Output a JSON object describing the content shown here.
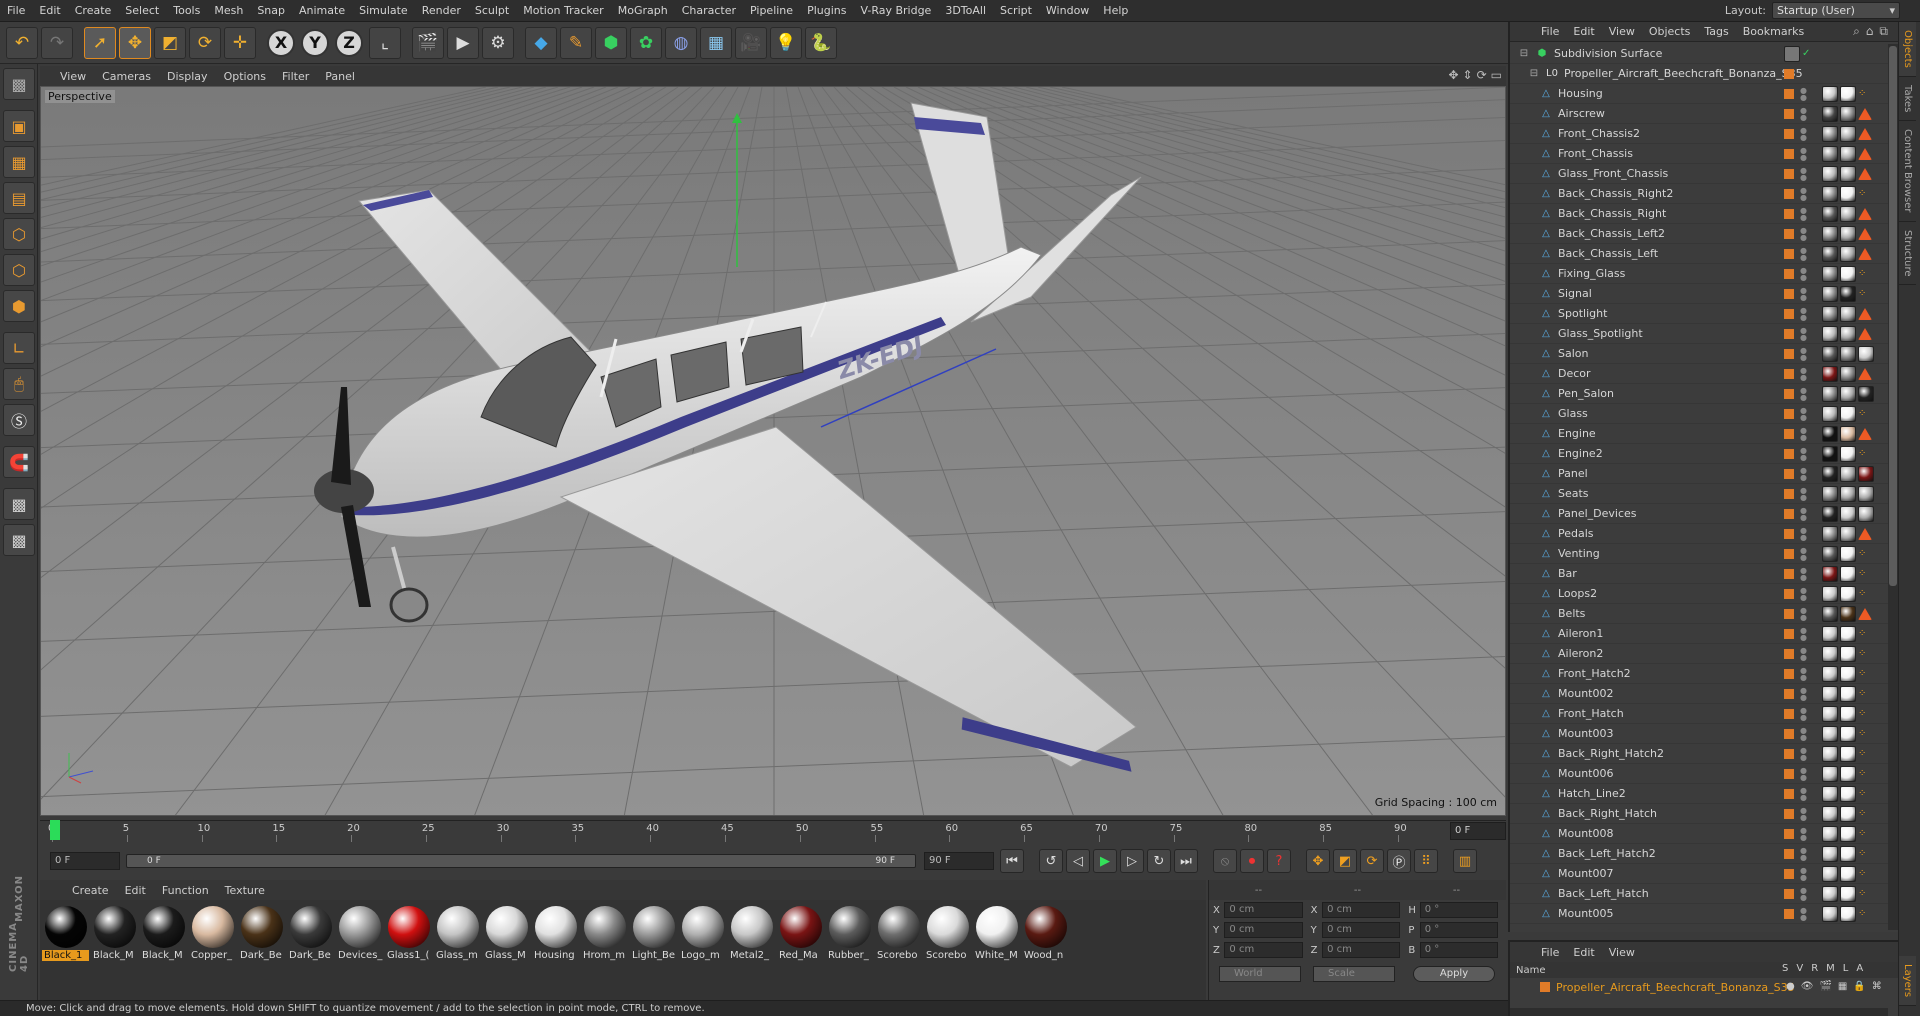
{
  "menubar": {
    "items": [
      "File",
      "Edit",
      "Create",
      "Select",
      "Tools",
      "Mesh",
      "Snap",
      "Animate",
      "Simulate",
      "Render",
      "Sculpt",
      "Motion Tracker",
      "MoGraph",
      "Character",
      "Pipeline",
      "Plugins",
      "V-Ray Bridge",
      "3DToAll",
      "Script",
      "Window",
      "Help"
    ],
    "layout_label": "Layout:",
    "layout_value": "Startup (User)"
  },
  "toolbar": {
    "axis_x": "X",
    "axis_y": "Y",
    "axis_z": "Z"
  },
  "viewport": {
    "menu": [
      "View",
      "Cameras",
      "Display",
      "Options",
      "Filter",
      "Panel"
    ],
    "label": "Perspective",
    "grid_spacing": "Grid Spacing : 100 cm",
    "tail_number": "ZK-EDJ"
  },
  "timeline": {
    "ticks": [
      "0",
      "5",
      "10",
      "15",
      "20",
      "25",
      "30",
      "35",
      "40",
      "45",
      "50",
      "55",
      "60",
      "65",
      "70",
      "75",
      "80",
      "85",
      "90"
    ],
    "end_frame": "0 F",
    "current_frame": "0 F",
    "range_start": "0 F",
    "range_end": "90 F",
    "max_frame": "90 F"
  },
  "materials": {
    "menu": [
      "Create",
      "Edit",
      "Function",
      "Texture"
    ],
    "items": [
      {
        "label": "Black_1",
        "color": "#050505",
        "selected": true
      },
      {
        "label": "Black_M",
        "color": "#222222"
      },
      {
        "label": "Black_M",
        "color": "#1b1b1b"
      },
      {
        "label": "Copper_",
        "color": "#d8b9a0"
      },
      {
        "label": "Dark_Be",
        "color": "#4a3218"
      },
      {
        "label": "Dark_Be",
        "color": "#3a3a3a"
      },
      {
        "label": "Devices_",
        "color": "#9a9a9a"
      },
      {
        "label": "Glass1_(",
        "color": "#d01010"
      },
      {
        "label": "Glass_m",
        "color": "#c4c4c4"
      },
      {
        "label": "Glass_M",
        "color": "#d8d8d8"
      },
      {
        "label": "Housing",
        "color": "#e0e0e0"
      },
      {
        "label": "Hrom_m",
        "color": "#888888"
      },
      {
        "label": "Light_Be",
        "color": "#9a9a9a"
      },
      {
        "label": "Logo_m",
        "color": "#b0b0b0"
      },
      {
        "label": "Metal2_",
        "color": "#c8c8c8"
      },
      {
        "label": "Red_Ma",
        "color": "#7a1414"
      },
      {
        "label": "Rubber_",
        "color": "#5c5c5c"
      },
      {
        "label": "Scorebo",
        "color": "#6e6e6e"
      },
      {
        "label": "Scorebo",
        "color": "#dadada"
      },
      {
        "label": "White_M",
        "color": "#f0f0f0"
      },
      {
        "label": "Wood_n",
        "color": "#5a1a12"
      }
    ]
  },
  "coords": {
    "head": [
      "--",
      "--",
      "--"
    ],
    "rows": [
      {
        "a": "X",
        "av": "0 cm",
        "b": "X",
        "bv": "0 cm",
        "c": "H",
        "cv": "0 °"
      },
      {
        "a": "Y",
        "av": "0 cm",
        "b": "Y",
        "bv": "0 cm",
        "c": "P",
        "cv": "0 °"
      },
      {
        "a": "Z",
        "av": "0 cm",
        "b": "Z",
        "bv": "0 cm",
        "c": "B",
        "cv": "0 °"
      }
    ],
    "world": "World",
    "scale": "Scale",
    "apply": "Apply"
  },
  "status": "Move: Click and drag to move elements. Hold down SHIFT to quantize movement / add to the selection in point mode, CTRL to remove.",
  "object_manager": {
    "menu": [
      "File",
      "Edit",
      "View",
      "Objects",
      "Tags",
      "Bookmarks"
    ],
    "root": "Subdivision Surface",
    "group": "Propeller_Aircraft_Beechcraft_Bonanza_S35",
    "objects": [
      {
        "name": "Housing",
        "tags": [
          "#c8c8c8",
          "#f0f0f0",
          "dots"
        ]
      },
      {
        "name": "Airscrew",
        "tags": [
          "#444444",
          "#888888",
          "tri"
        ]
      },
      {
        "name": "Front_Chassis2",
        "tags": [
          "#888888",
          "#aaaaaa",
          "tri"
        ]
      },
      {
        "name": "Front_Chassis",
        "tags": [
          "#888888",
          "#aaaaaa",
          "tri"
        ]
      },
      {
        "name": "Glass_Front_Chassis",
        "tags": [
          "#b8b8b8",
          "#aaaaaa",
          "tri"
        ]
      },
      {
        "name": "Back_Chassis_Right2",
        "tags": [
          "#888888",
          "#f0f0f0",
          "dots"
        ]
      },
      {
        "name": "Back_Chassis_Right",
        "tags": [
          "#555555",
          "#aaaaaa",
          "tri"
        ]
      },
      {
        "name": "Back_Chassis_Left2",
        "tags": [
          "#888888",
          "#aaaaaa",
          "tri"
        ]
      },
      {
        "name": "Back_Chassis_Left",
        "tags": [
          "#555555",
          "#aaaaaa",
          "tri"
        ]
      },
      {
        "name": "Fixing_Glass",
        "tags": [
          "#888888",
          "#f0f0f0",
          "dots"
        ]
      },
      {
        "name": "Signal",
        "tags": [
          "#888888",
          "#222222",
          "dots"
        ]
      },
      {
        "name": "Spotlight",
        "tags": [
          "#888888",
          "#aaaaaa",
          "tri"
        ]
      },
      {
        "name": "Glass_Spotlight",
        "tags": [
          "#b8b8b8",
          "#aaaaaa",
          "tri"
        ]
      },
      {
        "name": "Salon",
        "tags": [
          "#555555",
          "#888888",
          "#cccccc"
        ]
      },
      {
        "name": "Decor",
        "tags": [
          "#7a1414",
          "#888888",
          "tri"
        ]
      },
      {
        "name": "Pen_Salon",
        "tags": [
          "#888888",
          "#aaaaaa",
          "#222222"
        ]
      },
      {
        "name": "Glass",
        "tags": [
          "#b8b8b8",
          "#f0f0f0",
          "dots"
        ]
      },
      {
        "name": "Engine",
        "tags": [
          "#111111",
          "#d8b9a0",
          "tri"
        ]
      },
      {
        "name": "Engine2",
        "tags": [
          "#111111",
          "#f0f0f0",
          "dots"
        ]
      },
      {
        "name": "Panel",
        "tags": [
          "#222222",
          "#aaaaaa",
          "#7a1414"
        ]
      },
      {
        "name": "Seats",
        "tags": [
          "#888888",
          "#aaaaaa",
          "#aaaaaa"
        ]
      },
      {
        "name": "Panel_Devices",
        "tags": [
          "#222222",
          "#cccccc",
          "#aaaaaa"
        ]
      },
      {
        "name": "Pedals",
        "tags": [
          "#888888",
          "#aaaaaa",
          "tri"
        ]
      },
      {
        "name": "Venting",
        "tags": [
          "#555555",
          "#f0f0f0",
          "dots"
        ]
      },
      {
        "name": "Bar",
        "tags": [
          "#7a1414",
          "#f0f0f0",
          "dots"
        ]
      },
      {
        "name": "Loops2",
        "tags": [
          "#c8c8c8",
          "#f0f0f0",
          "dots"
        ]
      },
      {
        "name": "Belts",
        "tags": [
          "#555555",
          "#4a3218",
          "tri"
        ]
      },
      {
        "name": "Aileron1",
        "tags": [
          "#c8c8c8",
          "#f0f0f0",
          "dots"
        ]
      },
      {
        "name": "Aileron2",
        "tags": [
          "#c8c8c8",
          "#f0f0f0",
          "dots"
        ]
      },
      {
        "name": "Front_Hatch2",
        "tags": [
          "#c8c8c8",
          "#f0f0f0",
          "dots"
        ]
      },
      {
        "name": "Mount002",
        "tags": [
          "#c8c8c8",
          "#f0f0f0",
          "dots"
        ]
      },
      {
        "name": "Front_Hatch",
        "tags": [
          "#c8c8c8",
          "#f0f0f0",
          "dots"
        ]
      },
      {
        "name": "Mount003",
        "tags": [
          "#c8c8c8",
          "#f0f0f0",
          "dots"
        ]
      },
      {
        "name": "Back_Right_Hatch2",
        "tags": [
          "#c8c8c8",
          "#f0f0f0",
          "dots"
        ]
      },
      {
        "name": "Mount006",
        "tags": [
          "#c8c8c8",
          "#f0f0f0",
          "dots"
        ]
      },
      {
        "name": "Hatch_Line2",
        "tags": [
          "#c8c8c8",
          "#f0f0f0",
          "dots"
        ]
      },
      {
        "name": "Back_Right_Hatch",
        "tags": [
          "#c8c8c8",
          "#f0f0f0",
          "dots"
        ]
      },
      {
        "name": "Mount008",
        "tags": [
          "#c8c8c8",
          "#f0f0f0",
          "dots"
        ]
      },
      {
        "name": "Back_Left_Hatch2",
        "tags": [
          "#c8c8c8",
          "#f0f0f0",
          "dots"
        ]
      },
      {
        "name": "Mount007",
        "tags": [
          "#c8c8c8",
          "#f0f0f0",
          "dots"
        ]
      },
      {
        "name": "Back_Left_Hatch",
        "tags": [
          "#c8c8c8",
          "#f0f0f0",
          "dots"
        ]
      },
      {
        "name": "Mount005",
        "tags": [
          "#c8c8c8",
          "#f0f0f0",
          "dots"
        ]
      }
    ]
  },
  "layer_manager": {
    "menu": [
      "File",
      "Edit",
      "View"
    ],
    "col_name": "Name",
    "cols": [
      "S",
      "V",
      "R",
      "M",
      "L",
      "A"
    ],
    "layer": "Propeller_Aircraft_Beechcraft_Bonanza_S35"
  },
  "side_tabs": [
    "Objects",
    "Takes",
    "Content Browser",
    "Structure"
  ],
  "layers_tab": "Layers",
  "branding": {
    "line1": "MAXON",
    "line2": "CINEMA 4D"
  }
}
